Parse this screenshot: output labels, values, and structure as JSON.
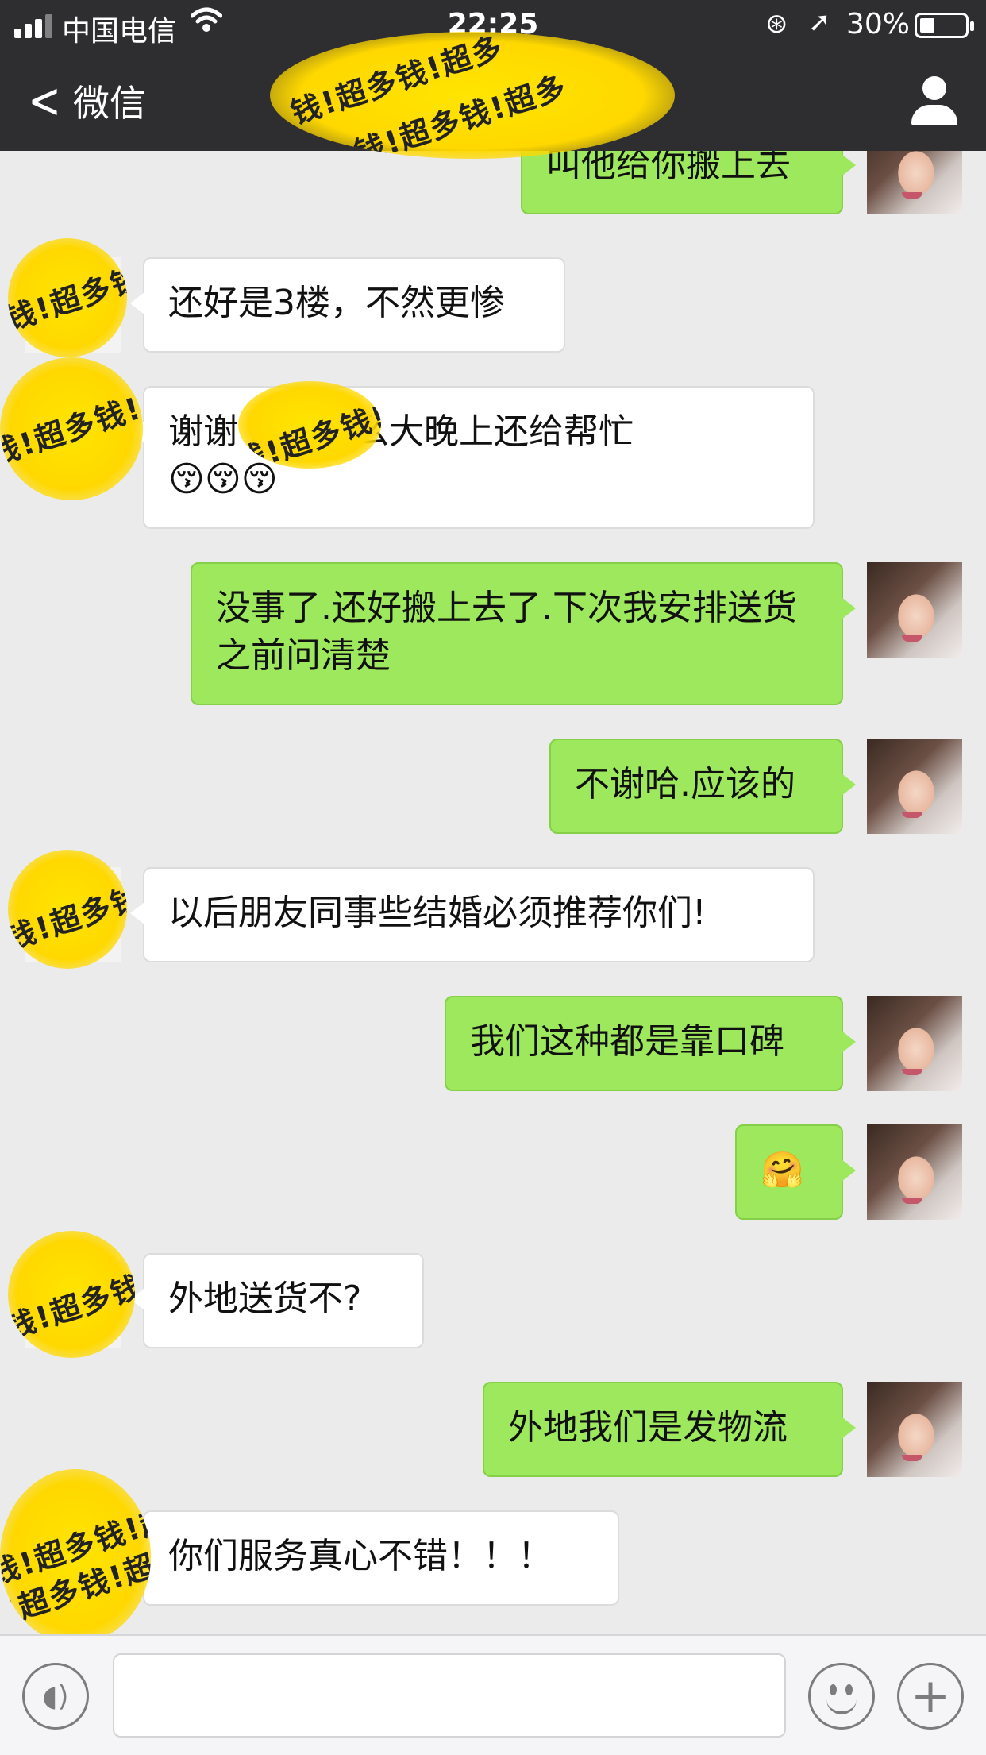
{
  "status_bar": {
    "carrier": "中国电信",
    "time": "22:25",
    "battery": "30%"
  },
  "nav": {
    "back_label": "微信"
  },
  "redaction_text": "钱!超多钱!超多",
  "messages": [
    {
      "side": "right",
      "text": "叫他给你搬上去"
    },
    {
      "side": "left",
      "text": "还好是3楼，不然更惨"
    },
    {
      "side": "left",
      "text": "谢谢  哦，这么大晚上还给帮忙",
      "emoji": "😚😚😚"
    },
    {
      "side": "right",
      "text": "没事了.还好搬上去了.下次我安排送货之前问清楚"
    },
    {
      "side": "right",
      "text": "不谢哈.应该的"
    },
    {
      "side": "left",
      "text": "以后朋友同事些结婚必须推荐你们!"
    },
    {
      "side": "right",
      "text": "我们这种都是靠口碑"
    },
    {
      "side": "right",
      "emoji": "🤗"
    },
    {
      "side": "left",
      "text": "外地送货不?"
    },
    {
      "side": "right",
      "text": "外地我们是发物流"
    },
    {
      "side": "left",
      "text": "你们服务真心不错！！！"
    }
  ],
  "colors": {
    "nav_bg": "#2e2e30",
    "chat_bg": "#ebebeb",
    "bubble_self": "#9ee85e",
    "bubble_other": "#ffffff"
  }
}
